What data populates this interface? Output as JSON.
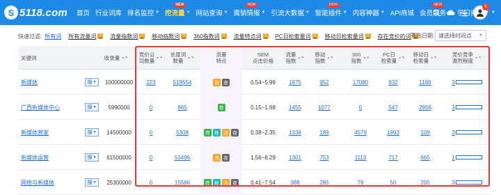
{
  "brand": {
    "logo_mark": "S",
    "logo_text": "5118.com"
  },
  "nav": [
    {
      "label": "首页",
      "has_caret": false,
      "is_new": false,
      "active": false
    },
    {
      "label": "行业词库",
      "has_caret": false,
      "is_new": false,
      "active": false
    },
    {
      "label": "排名监控",
      "has_caret": true,
      "is_new": false,
      "active": false
    },
    {
      "label": "挖流量",
      "has_caret": true,
      "is_new": true,
      "active": true
    },
    {
      "label": "网站查询",
      "has_caret": true,
      "is_new": false,
      "active": false
    },
    {
      "label": "需销情报",
      "has_caret": true,
      "is_new": true,
      "active": false
    },
    {
      "label": "引流大数据",
      "has_caret": true,
      "is_new": false,
      "active": false
    },
    {
      "label": "智能插件",
      "has_caret": true,
      "is_new": true,
      "active": false
    },
    {
      "label": "内容神器",
      "has_caret": true,
      "is_new": false,
      "active": false
    },
    {
      "label": "API商城",
      "has_caret": false,
      "is_new": false,
      "active": false
    },
    {
      "label": "会员服务",
      "has_caret": true,
      "is_new": true,
      "active": false
    },
    {
      "label": "学习排名",
      "has_caret": true,
      "is_new": false,
      "active": false
    }
  ],
  "badge_new_label": "NEW",
  "tools": [
    "search-icon",
    "cloud-icon",
    "download-icon"
  ],
  "avatar_badge": "5",
  "filter": {
    "label": "快速过滤:",
    "chips": [
      {
        "label": "所有词",
        "selected": true
      },
      {
        "label": "所有流量词",
        "selected": false
      },
      {
        "label": "流量指数词",
        "selected": false
      },
      {
        "label": "移动指数词",
        "selected": false
      },
      {
        "label": "360指数词",
        "selected": false
      },
      {
        "label": "流量特点词",
        "selected": false
      },
      {
        "label": "PC日检索量词",
        "selected": false
      },
      {
        "label": "移动日检索量词",
        "selected": false
      },
      {
        "label": "存在竞价的词",
        "selected": false
      }
    ],
    "chip_help": "?",
    "date_label": "筛选日期:",
    "date_value": "请选择时间点"
  },
  "columns": {
    "keyword": "关键词",
    "collect": "收录量",
    "bid_count": "竞价公\n司数量",
    "longtail": "长尾词\n数量",
    "feature": "流量\n特点",
    "sem": "SEM\n点击价格",
    "traffic": "流量\n指数",
    "mobile": "移动\n指数",
    "idx360": "360\n指数",
    "pc_daily": "PC日\n检索量",
    "mobile_daily": "移动日\n检索量",
    "competition": "竞价竞争\n激烈程度"
  },
  "bd_label": "搜",
  "rows": [
    {
      "keyword": "新媒体",
      "collect": "100000000",
      "bid_count": "223",
      "longtail": "519554",
      "tags": [
        {
          "t": "流",
          "c": "o"
        },
        {
          "t": "夜",
          "c": "d"
        }
      ],
      "sem": "0.54~5.99",
      "traffic": "1875",
      "mobile": "952",
      "idx360": "17080",
      "pc_daily": "932",
      "mobile_daily": "1186",
      "competition": "3",
      "competition_ratio": 0.15
    },
    {
      "keyword": "广西新媒体中心",
      "collect": "5990000",
      "bid_count": "0",
      "longtail": "665",
      "tags": [
        {
          "t": "荐",
          "c": "g"
        }
      ],
      "sem": "0.15~1.68",
      "traffic": "1455",
      "mobile": "1077",
      "idx360": "0",
      "pc_daily": "547",
      "mobile_daily": "2956",
      "competition": "3",
      "competition_ratio": 0.15
    },
    {
      "keyword": "新媒体营家",
      "collect": "14500000",
      "bid_count": "0",
      "longtail": "5308",
      "tags": [
        {
          "t": "荐",
          "c": "g"
        },
        {
          "t": "移",
          "c": "t"
        },
        {
          "t": "流",
          "c": "o"
        },
        {
          "t": "夜",
          "c": "d"
        }
      ],
      "sem": "0.38~2.35",
      "traffic": "1338",
      "mobile": "189",
      "idx360": "4579",
      "pc_daily": "1993",
      "mobile_daily": "109",
      "competition": "3",
      "competition_ratio": 0.15
    },
    {
      "keyword": "新媒体运营",
      "collect": "61500000",
      "bid_count": "0",
      "longtail": "53496",
      "tags": [
        {
          "t": "流",
          "c": "o"
        },
        {
          "t": "夜",
          "c": "d"
        }
      ],
      "sem": "1.56~8.29",
      "traffic": "1301",
      "mobile": "753",
      "idx360": "1113",
      "pc_daily": "717",
      "mobile_daily": "665",
      "competition": "1",
      "competition_ratio": 0.05
    },
    {
      "keyword": "网络与新媒体",
      "collect": "25300000",
      "bid_count": "0",
      "longtail": "15586",
      "tags": [
        {
          "t": "荐",
          "c": "g"
        },
        {
          "t": "移",
          "c": "t"
        },
        {
          "t": "流",
          "c": "o"
        },
        {
          "t": "夜",
          "c": "d"
        }
      ],
      "sem": "0.41~7.54",
      "traffic": "388",
      "mobile": "285",
      "idx360": "79",
      "pc_daily": "50",
      "mobile_daily": "205",
      "competition": "3",
      "competition_ratio": 0.15
    }
  ],
  "colors": {
    "nav_bg": "#1e8ae6",
    "active_nav": "#ffd84a",
    "link": "#1e6fd9",
    "highlight_box": "#e53935"
  }
}
